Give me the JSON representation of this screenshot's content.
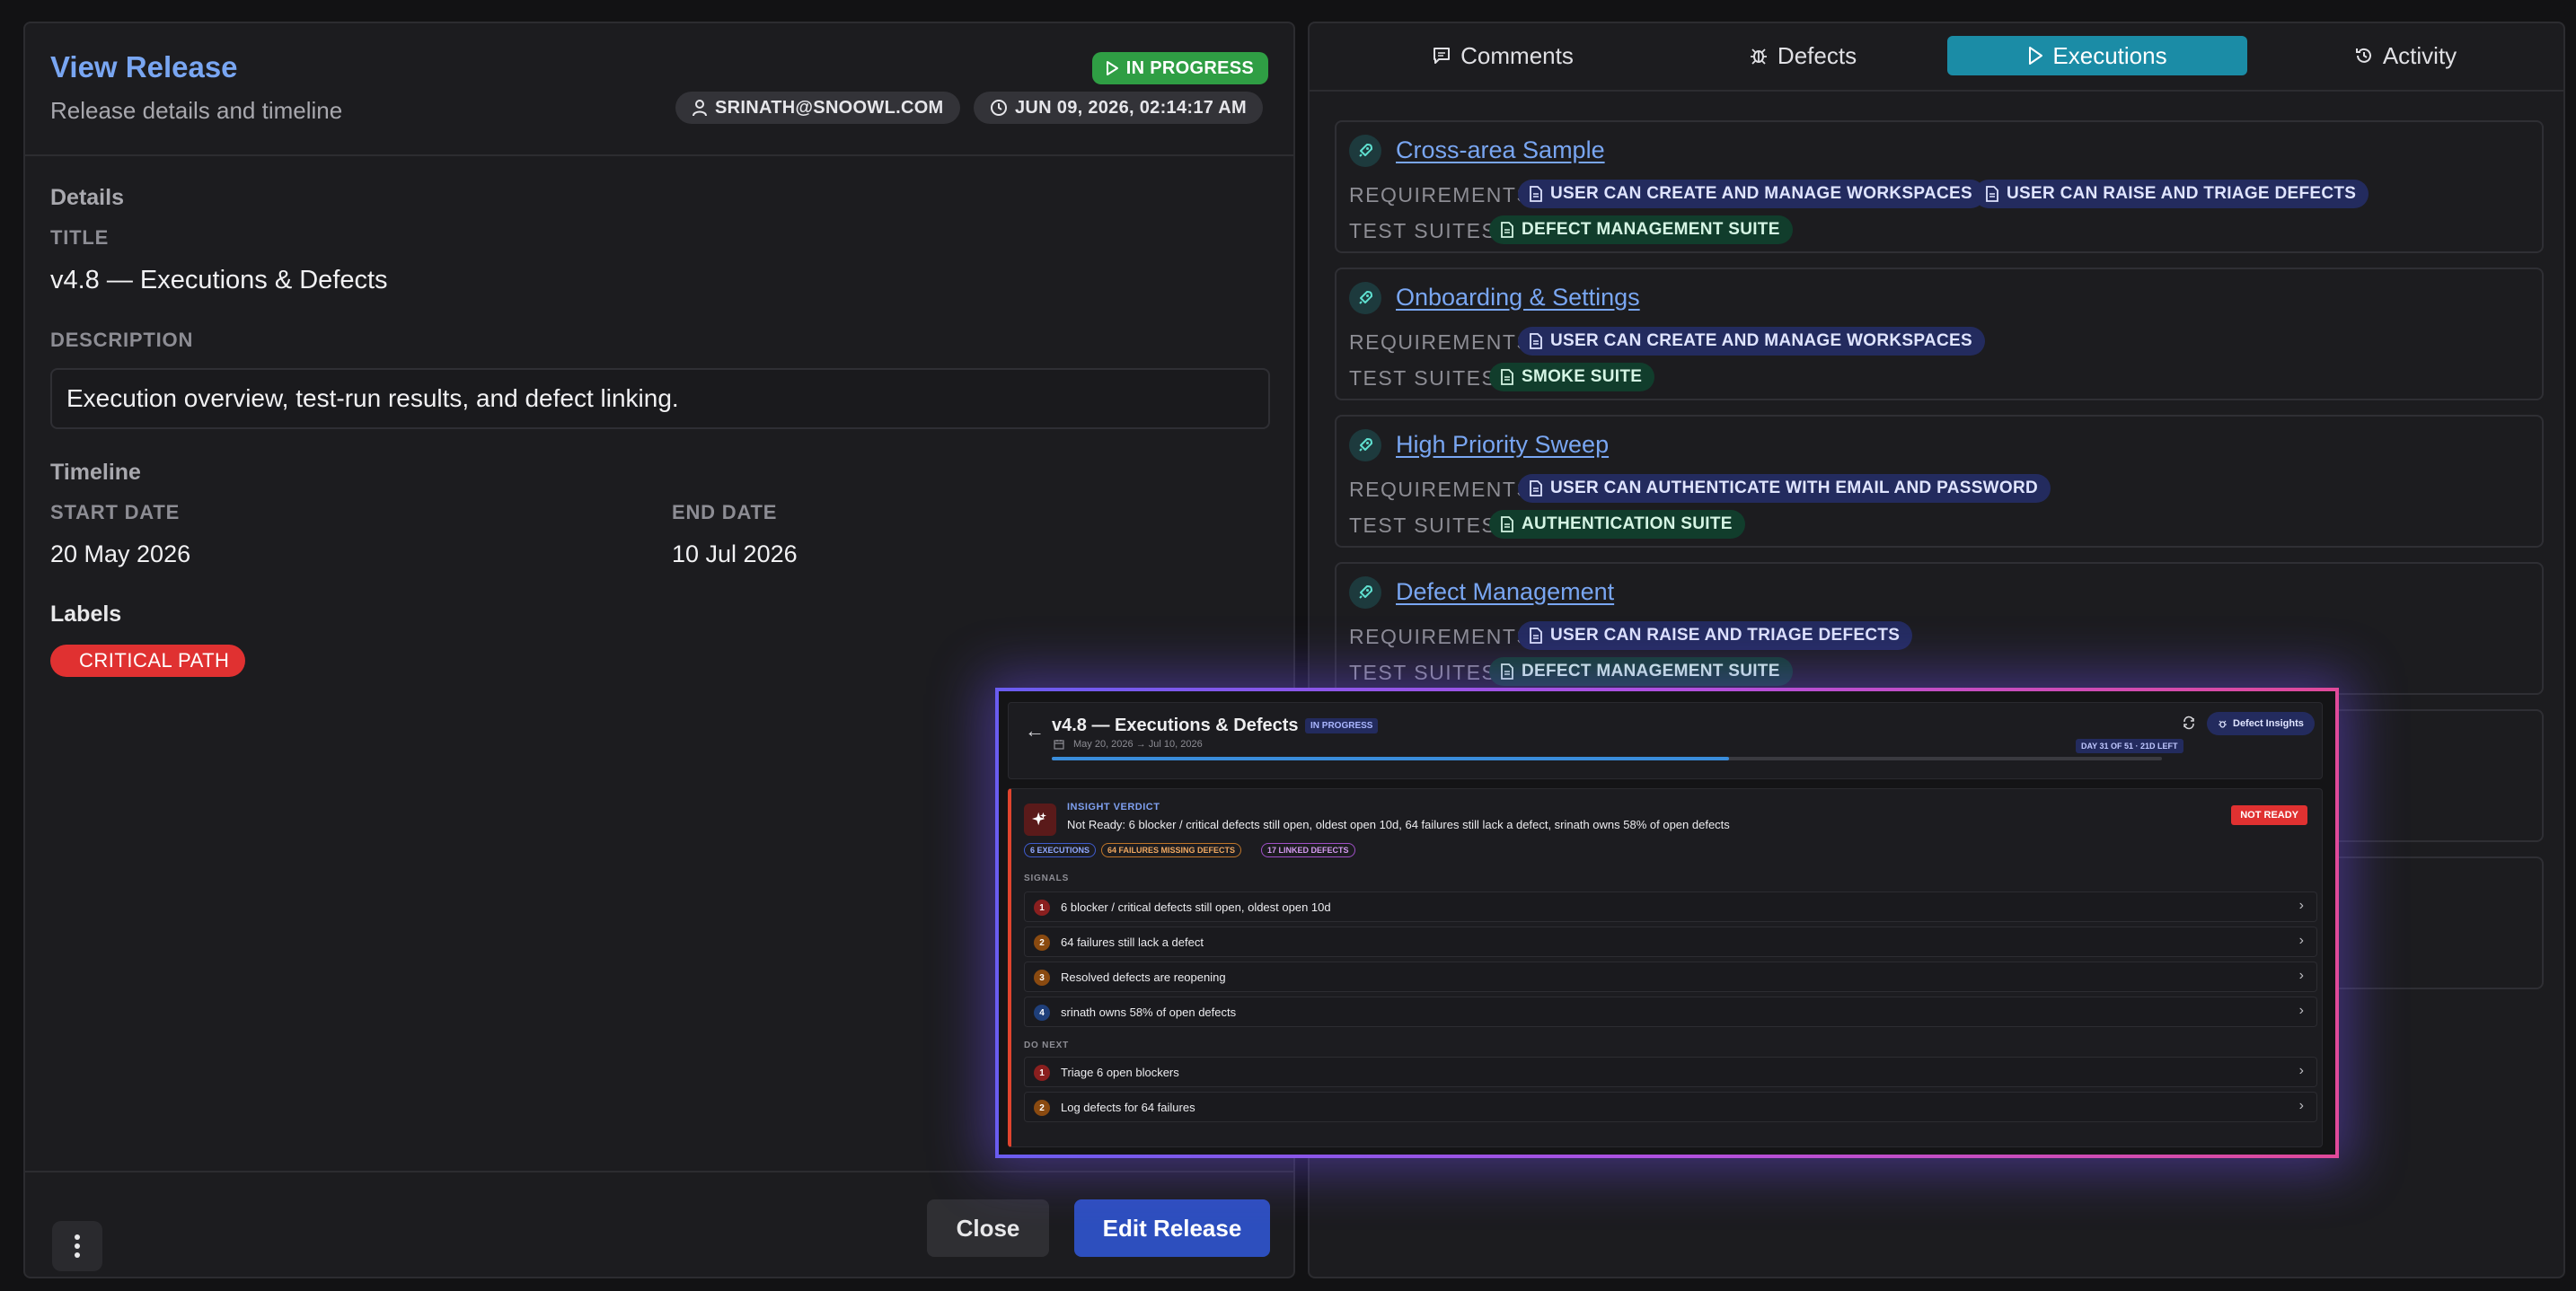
{
  "view": {
    "title": "View Release",
    "subtitle": "Release details and timeline",
    "status": "IN PROGRESS",
    "owner": "SRINATH@SNOOWL.COM",
    "timestamp": "JUN 09, 2026, 02:14:17 AM",
    "details_heading": "Details",
    "title_label": "TITLE",
    "title_value": "v4.8 — Executions & Defects",
    "description_label": "DESCRIPTION",
    "description_value": "Execution overview, test-run results, and defect linking.",
    "timeline_heading": "Timeline",
    "start_label": "START DATE",
    "start_value": "20 May 2026",
    "end_label": "END DATE",
    "end_value": "10 Jul 2026",
    "labels_heading": "Labels",
    "label_pill": "CRITICAL PATH",
    "close_label": "Close",
    "edit_label": "Edit Release"
  },
  "tabs": [
    {
      "label": "Comments",
      "icon": "comment-icon",
      "active": false
    },
    {
      "label": "Defects",
      "icon": "bug-icon",
      "active": false
    },
    {
      "label": "Executions",
      "icon": "play-icon",
      "active": true
    },
    {
      "label": "Activity",
      "icon": "history-icon",
      "active": false
    }
  ],
  "executions": {
    "requirements_label": "REQUIREMENTS",
    "suites_label": "TEST SUITES",
    "items": [
      {
        "title": "Cross-area Sample",
        "requirements": [
          "USER CAN CREATE AND MANAGE WORKSPACES",
          "USER CAN RAISE AND TRIAGE DEFECTS"
        ],
        "suites": [
          "DEFECT MANAGEMENT SUITE"
        ]
      },
      {
        "title": "Onboarding & Settings",
        "requirements": [
          "USER CAN CREATE AND MANAGE WORKSPACES"
        ],
        "suites": [
          "SMOKE SUITE"
        ]
      },
      {
        "title": "High Priority Sweep",
        "requirements": [
          "USER CAN AUTHENTICATE WITH EMAIL AND PASSWORD"
        ],
        "suites": [
          "AUTHENTICATION SUITE"
        ]
      },
      {
        "title": "Defect Management",
        "requirements": [
          "USER CAN RAISE AND TRIAGE DEFECTS"
        ],
        "suites": [
          "DEFECT MANAGEMENT SUITE"
        ]
      }
    ]
  },
  "overlay": {
    "title": "v4.8 — Executions & Defects",
    "status": "IN PROGRESS",
    "dates": "May 20, 2026 → Jul 10, 2026",
    "progress": 0.61,
    "day_badge": "DAY 31 OF 51 · 21D LEFT",
    "insights_label": "Defect Insights",
    "verdict_tag": "INSIGHT VERDICT",
    "verdict_text": "Not Ready: 6 blocker / critical defects still open, oldest open 10d, 64 failures still lack a defect, srinath owns 58% of open defects",
    "verdict_badge": "NOT READY",
    "chips": [
      "6 EXECUTIONS",
      "64 FAILURES MISSING DEFECTS",
      "17 LINKED DEFECTS"
    ],
    "signals_label": "SIGNALS",
    "signals": [
      {
        "num": "1",
        "text": "6 blocker / critical defects still open, oldest open 10d",
        "color": "#8a1f1f"
      },
      {
        "num": "2",
        "text": "64 failures still lack a defect",
        "color": "#8a4a10"
      },
      {
        "num": "3",
        "text": "Resolved defects are reopening",
        "color": "#8a4a10"
      },
      {
        "num": "4",
        "text": "srinath owns 58% of open defects",
        "color": "#1f3f7a"
      }
    ],
    "next_label": "DO NEXT",
    "next": [
      {
        "num": "1",
        "text": "Triage 6 open blockers",
        "color": "#8a1f1f"
      },
      {
        "num": "2",
        "text": "Log defects for 64 failures",
        "color": "#8a4a10"
      }
    ]
  }
}
